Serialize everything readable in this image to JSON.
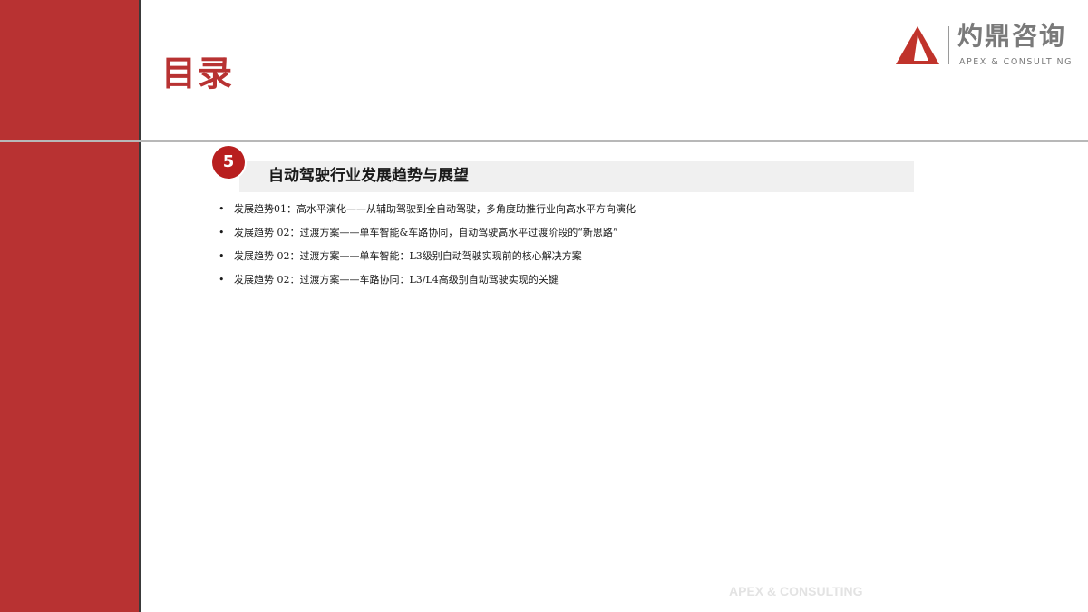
{
  "page": {
    "title": "目录"
  },
  "logo": {
    "icon": "triangle-logo-icon",
    "name_cn": "灼鼎咨询",
    "name_en": "APEX & CONSULTING",
    "mark_color": "#c0332b"
  },
  "section": {
    "number": "5",
    "title": "自动驾驶行业发展趋势与展望",
    "badge_color": "#b81f1f"
  },
  "trends": [
    {
      "text": "发展趋势01：高水平演化——从辅助驾驶到全自动驾驶，多角度助推行业向高水平方向演化"
    },
    {
      "text": "发展趋势 02：过渡方案——单车智能&车路协同，自动驾驶高水平过渡阶段的“新思路”"
    },
    {
      "text": "发展趋势 02：过渡方案——单车智能：L3级别自动驾驶实现前的核心解决方案"
    },
    {
      "text": "发展趋势 02：过渡方案——车路协同：L3/L4高级别自动驾驶实现的关键"
    }
  ],
  "footer": {
    "text": "APEX & CONSULTING"
  },
  "colors": {
    "accent_red": "#b83232",
    "divider_gray": "#b8b8b8"
  }
}
